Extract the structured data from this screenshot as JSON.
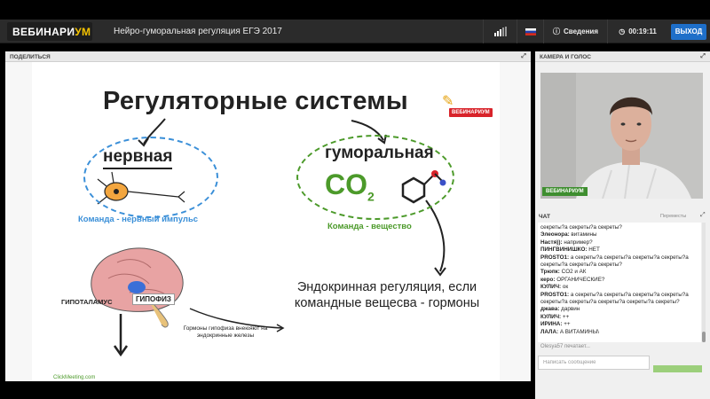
{
  "brand": {
    "logo_main": "ВЕБИНАРИ",
    "logo_accent": "УМ"
  },
  "header": {
    "title": "Нейро-гуморальная регуляция  ЕГЭ 2017",
    "info_label": "Сведения",
    "timer": "00:19:11",
    "exit_label": "ВЫХОД"
  },
  "share_panel": {
    "title": "ПОДЕЛИТЬСЯ"
  },
  "slide": {
    "title": "Регуляторные системы",
    "badge": "ВЕБИНАРИУМ",
    "nervous_word": "нервная",
    "nervous_command": "Команда - нервный импульс",
    "humoral_word": "гуморальная",
    "co2_main": "CO",
    "co2_sub": "2",
    "humoral_command": "Команда - вещество",
    "endocrine_text": "Эндокринная регуляция, если командные вещесва - гормоны",
    "hypothalamus_label": "ГИПОТАЛАМУС",
    "pituitary_label": "ГИПОФИЗ",
    "hormones_text": "Гормоны гипофиза внеюяют на эндокринные железы",
    "footer_link": "ClickMeeting.com"
  },
  "camera_panel": {
    "title": "КАМЕРА И ГОЛОС",
    "badge": "ВЕБИНАРИУМ"
  },
  "chat": {
    "title": "ЧАТ",
    "popout": "Переместы",
    "messages": [
      {
        "author": "",
        "text": "секреты?а секреты?а секреты?"
      },
      {
        "author": "Элеонора:",
        "text": " витамины"
      },
      {
        "author": "Настя)):",
        "text": " например?"
      },
      {
        "author": "ПИНГВИНИШКО:",
        "text": " НЕТ"
      },
      {
        "author": "PROSTO1:",
        "text": " а секреты?а секреты?а секреты?а секреты?а секреты?а секреты?а секреты?"
      },
      {
        "author": "Трюпк:",
        "text": " CO2 и АК"
      },
      {
        "author": "керо:",
        "text": " ОРГАНИЧЕСКИЕ?"
      },
      {
        "author": "КУЛИЧ:",
        "text": " ок"
      },
      {
        "author": "PROSTO1:",
        "text": " а секреты?а секреты?а секреты?а секреты?а секреты?а секреты?а секреты?а секреты?а секреты?"
      },
      {
        "author": "джава:",
        "text": " дарвин"
      },
      {
        "author": "КУЛИЧ:",
        "text": " ++"
      },
      {
        "author": "ИРИНА:",
        "text": " ++"
      },
      {
        "author": "ЛАЛА:",
        "text": " А ВИТАМИНЫ\\"
      }
    ],
    "typing": "Olesya57 печатает...",
    "input_placeholder": "Написать сообщение"
  },
  "colors": {
    "blue": "#3a8fd8",
    "green": "#4c9a2a",
    "red": "#d8232a",
    "exit": "#1e6fc9"
  }
}
